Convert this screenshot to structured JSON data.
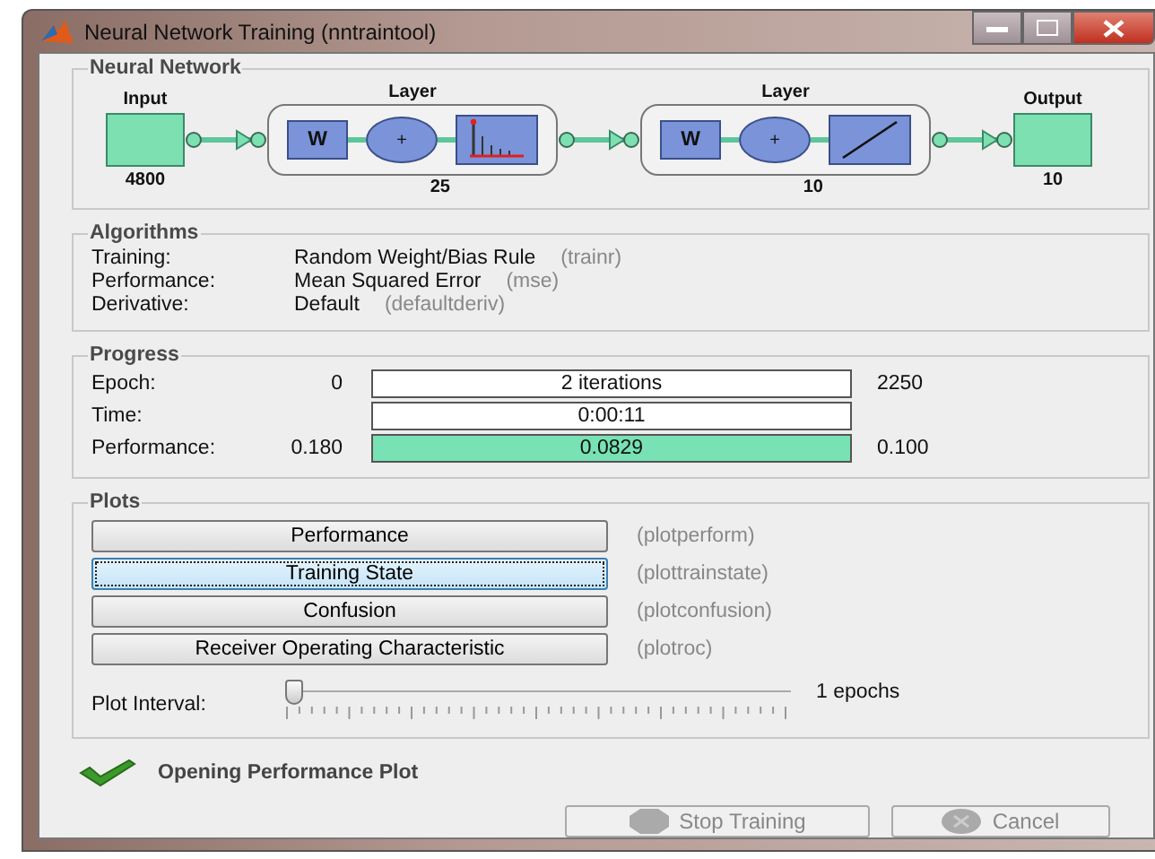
{
  "window": {
    "title": "Neural Network Training (nntraintool)"
  },
  "network": {
    "title": "Neural Network",
    "input": {
      "label": "Input",
      "size": "4800"
    },
    "layers": [
      {
        "label": "Layer",
        "weight": "W",
        "sum": "+",
        "kind": "bars",
        "size": "25"
      },
      {
        "label": "Layer",
        "weight": "W",
        "sum": "+",
        "kind": "line",
        "size": "10"
      }
    ],
    "output": {
      "label": "Output",
      "size": "10"
    }
  },
  "algorithms": {
    "title": "Algorithms",
    "rows": [
      {
        "label": "Training:",
        "value": "Random Weight/Bias Rule",
        "code": "(trainr)"
      },
      {
        "label": "Performance:",
        "value": "Mean Squared Error",
        "code": "(mse)"
      },
      {
        "label": "Derivative:",
        "value": "Default",
        "code": "(defaultderiv)"
      }
    ]
  },
  "progress": {
    "title": "Progress",
    "rows": [
      {
        "label": "Epoch:",
        "start": "0",
        "text": "2 iterations",
        "end": "2250"
      },
      {
        "label": "Time:",
        "text": "0:00:11"
      },
      {
        "label": "Performance:",
        "start": "0.180",
        "text": "0.0829",
        "end": "0.100",
        "level": 1
      }
    ]
  },
  "plots": {
    "title": "Plots",
    "buttons": [
      {
        "label": "Performance",
        "code": "(plotperform)",
        "focused": false
      },
      {
        "label": "Training State",
        "code": "(plottrainstate)",
        "focused": true
      },
      {
        "label": "Confusion",
        "code": "(plotconfusion)",
        "focused": false
      },
      {
        "label": "Receiver Operating Characteristic",
        "code": "(plotroc)",
        "focused": false
      }
    ],
    "interval": {
      "label": "Plot Interval:",
      "level": 0,
      "reading": "1 epochs"
    }
  },
  "status": {
    "text": "Opening Performance Plot"
  },
  "buttons": [
    {
      "label": "Stop Training",
      "kind": "stop",
      "disabled": true
    },
    {
      "label": "Cancel",
      "kind": "cancel",
      "disabled": true
    }
  ]
}
